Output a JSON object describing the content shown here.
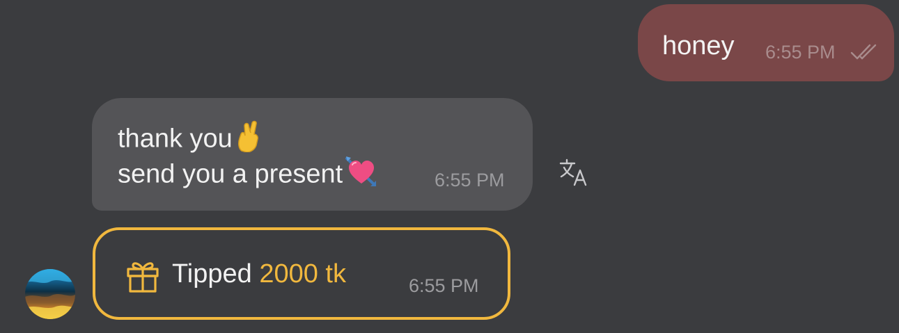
{
  "messages": {
    "outgoing": {
      "text": "honey",
      "time": "6:55 PM",
      "status_icon": "double-check-icon",
      "bubble_color": "#7a4748"
    },
    "incoming": {
      "line1": "thank you",
      "line1_emoji": "crossed-fingers-emoji",
      "line2": "send you a present",
      "line2_emoji": "heart-with-arrow-emoji",
      "time": "6:55 PM",
      "bubble_color": "#545457"
    },
    "tip": {
      "prefix": "Tipped",
      "amount": "2000 tk",
      "time": "6:55 PM",
      "icon": "gift-icon",
      "accent_color": "#f1b83e"
    }
  },
  "actions": {
    "translate_icon": "translate-icon"
  },
  "colors": {
    "background": "#3b3c3f",
    "accent": "#f1b83e"
  }
}
